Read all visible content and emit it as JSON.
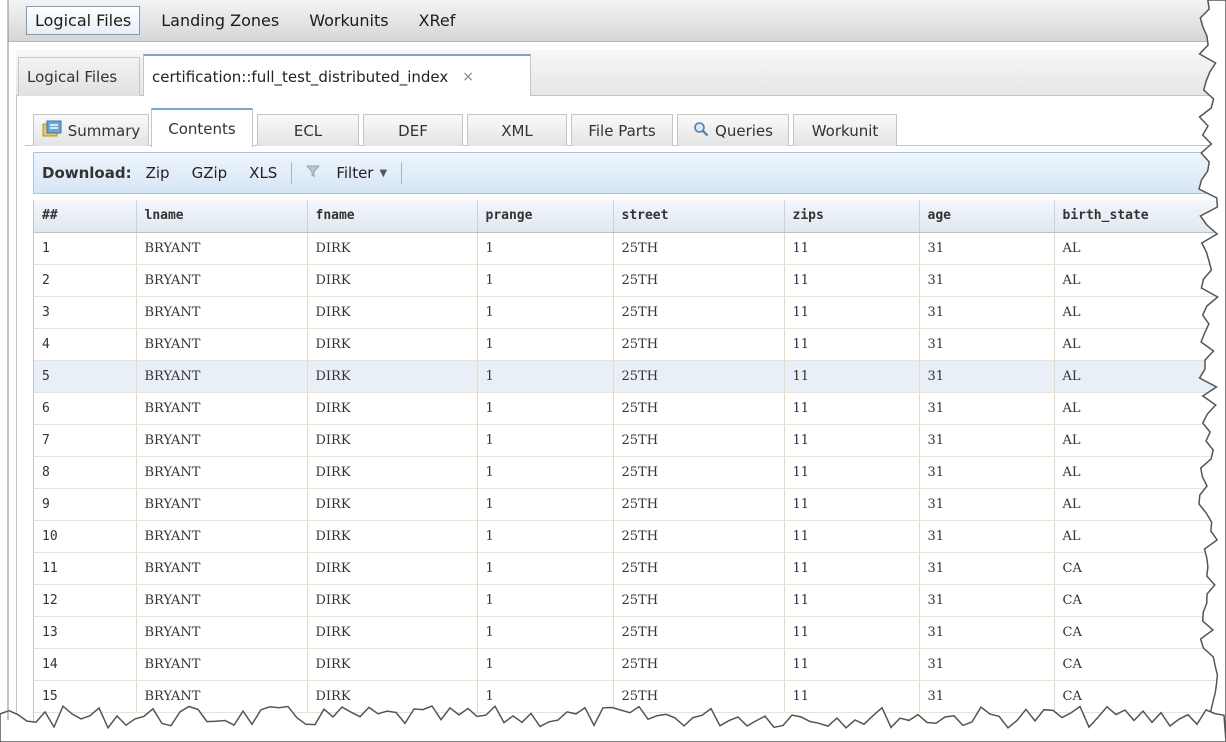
{
  "topnav": {
    "items": [
      "Logical Files",
      "Landing Zones",
      "Workunits",
      "XRef"
    ]
  },
  "filetabs": {
    "items": [
      "Logical Files",
      "certification::full_test_distributed_index"
    ],
    "close_glyph": "×"
  },
  "subtabs": {
    "items": [
      "Summary",
      "Contents",
      "ECL",
      "DEF",
      "XML",
      "File Parts",
      "Queries",
      "Workunit"
    ]
  },
  "toolbar": {
    "download_label": "Download:",
    "zip": "Zip",
    "gzip": "GZip",
    "xls": "XLS",
    "filter": "Filter"
  },
  "grid": {
    "columns": [
      "##",
      "lname",
      "fname",
      "prange",
      "street",
      "zips",
      "age",
      "birth_state"
    ],
    "rows": [
      [
        "1",
        "BRYANT",
        "DIRK",
        "1",
        "25TH",
        "11",
        "31",
        "AL"
      ],
      [
        "2",
        "BRYANT",
        "DIRK",
        "1",
        "25TH",
        "11",
        "31",
        "AL"
      ],
      [
        "3",
        "BRYANT",
        "DIRK",
        "1",
        "25TH",
        "11",
        "31",
        "AL"
      ],
      [
        "4",
        "BRYANT",
        "DIRK",
        "1",
        "25TH",
        "11",
        "31",
        "AL"
      ],
      [
        "5",
        "BRYANT",
        "DIRK",
        "1",
        "25TH",
        "11",
        "31",
        "AL"
      ],
      [
        "6",
        "BRYANT",
        "DIRK",
        "1",
        "25TH",
        "11",
        "31",
        "AL"
      ],
      [
        "7",
        "BRYANT",
        "DIRK",
        "1",
        "25TH",
        "11",
        "31",
        "AL"
      ],
      [
        "8",
        "BRYANT",
        "DIRK",
        "1",
        "25TH",
        "11",
        "31",
        "AL"
      ],
      [
        "9",
        "BRYANT",
        "DIRK",
        "1",
        "25TH",
        "11",
        "31",
        "AL"
      ],
      [
        "10",
        "BRYANT",
        "DIRK",
        "1",
        "25TH",
        "11",
        "31",
        "AL"
      ],
      [
        "11",
        "BRYANT",
        "DIRK",
        "1",
        "25TH",
        "11",
        "31",
        "CA"
      ],
      [
        "12",
        "BRYANT",
        "DIRK",
        "1",
        "25TH",
        "11",
        "31",
        "CA"
      ],
      [
        "13",
        "BRYANT",
        "DIRK",
        "1",
        "25TH",
        "11",
        "31",
        "CA"
      ],
      [
        "14",
        "BRYANT",
        "DIRK",
        "1",
        "25TH",
        "11",
        "31",
        "CA"
      ],
      [
        "15",
        "BRYANT",
        "DIRK",
        "1",
        "25TH",
        "11",
        "31",
        "CA"
      ]
    ],
    "highlighted_row": 5
  },
  "icons": {
    "summary": "summary-icon",
    "queries": "magnifier-icon",
    "filter": "funnel-icon",
    "filter_caret": "caret-down-icon",
    "close": "close-icon"
  },
  "colors": {
    "tab_accent": "#7aa6d0",
    "toolbar_bg": "#d6e6f4",
    "row_highlight": "#e9eff7"
  }
}
